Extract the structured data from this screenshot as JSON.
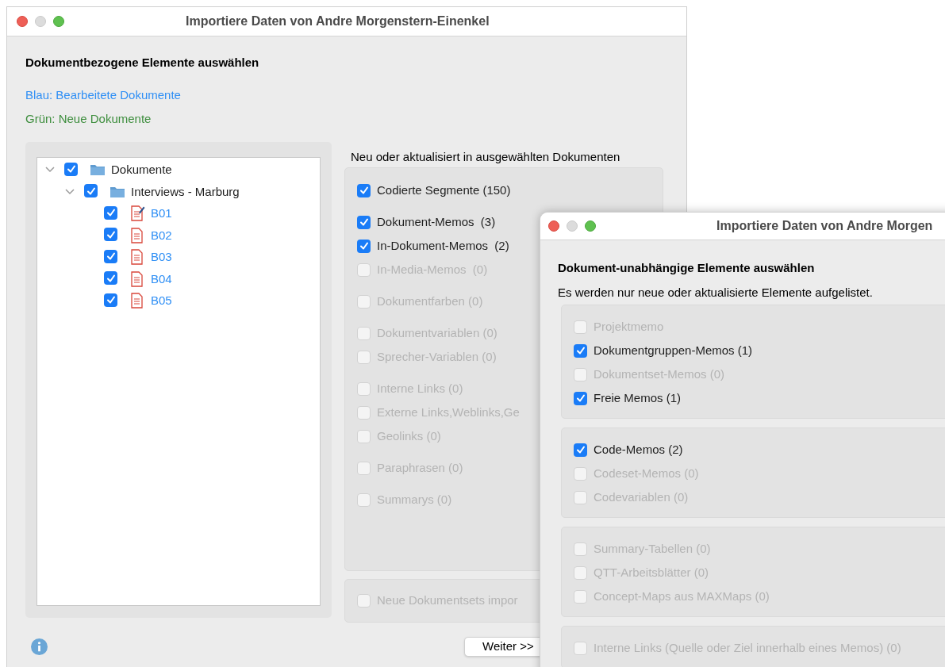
{
  "main_window": {
    "title": "Importiere Daten von Andre Morgenstern-Einenkel",
    "heading": "Dokumentbezogene Elemente auswählen",
    "legend": [
      {
        "kind": "edited",
        "label": "Blau: Bearbeitete Dokumente"
      },
      {
        "kind": "new",
        "label": "Grün: Neue Dokumente"
      }
    ],
    "tree": [
      {
        "label": "Dokumente",
        "kind": "folder",
        "checked": true,
        "expanded": true,
        "children": [
          {
            "label": "Interviews - Marburg",
            "kind": "folder",
            "checked": true,
            "expanded": true,
            "children": [
              {
                "label": "B01",
                "kind": "edited-document",
                "checked": true,
                "color": "#2f8ff5"
              },
              {
                "label": "B02",
                "kind": "document",
                "checked": true,
                "color": "#2f8ff5"
              },
              {
                "label": "B03",
                "kind": "document",
                "checked": true,
                "color": "#2f8ff5"
              },
              {
                "label": "B04",
                "kind": "document",
                "checked": true,
                "color": "#2f8ff5"
              },
              {
                "label": "B05",
                "kind": "document",
                "checked": true,
                "color": "#2f8ff5"
              }
            ]
          }
        ]
      }
    ],
    "options_label": "Neu oder aktualisiert in ausgewählten Dokumenten",
    "option_groups": [
      [
        {
          "label": "Codierte Segmente (150)",
          "checked": true,
          "disabled": false
        }
      ],
      [
        {
          "label": "Dokument-Memos  (3)",
          "checked": true,
          "disabled": false
        },
        {
          "label": "In-Dokument-Memos  (2)",
          "checked": true,
          "disabled": false
        },
        {
          "label": "In-Media-Memos  (0)",
          "checked": false,
          "disabled": true
        }
      ],
      [
        {
          "label": "Dokumentfarben (0)",
          "checked": false,
          "disabled": true
        }
      ],
      [
        {
          "label": "Dokumentvariablen (0)",
          "checked": false,
          "disabled": true
        },
        {
          "label": "Sprecher-Variablen (0)",
          "checked": false,
          "disabled": true
        }
      ],
      [
        {
          "label": "Interne Links (0)",
          "checked": false,
          "disabled": true
        },
        {
          "label": "Externe Links,Weblinks,Ge",
          "checked": false,
          "disabled": true
        },
        {
          "label": "Geolinks (0)",
          "checked": false,
          "disabled": true
        }
      ],
      [
        {
          "label": "Paraphrasen (0)",
          "checked": false,
          "disabled": true
        }
      ],
      [
        {
          "label": "Summarys (0)",
          "checked": false,
          "disabled": true
        }
      ]
    ],
    "extra_option": {
      "label": "Neue Dokumentsets impor",
      "checked": false,
      "disabled": true
    },
    "buttons": [
      "Weiter >>"
    ]
  },
  "second_window": {
    "title": "Importiere Daten von Andre Morgen",
    "heading": "Dokument-unabhängige Elemente auswählen",
    "subtitle": "Es werden nur neue oder aktualisierte Elemente aufgelistet.",
    "option_groups": [
      [
        {
          "label": "Projektmemo",
          "checked": false,
          "disabled": true
        },
        {
          "label": "Dokumentgruppen-Memos (1)",
          "checked": true,
          "disabled": false
        },
        {
          "label": "Dokumentset-Memos (0)",
          "checked": false,
          "disabled": true
        },
        {
          "label": "Freie Memos (1)",
          "checked": true,
          "disabled": false
        }
      ],
      [
        {
          "label": "Code-Memos (2)",
          "checked": true,
          "disabled": false
        },
        {
          "label": "Codeset-Memos (0)",
          "checked": false,
          "disabled": true
        },
        {
          "label": "Codevariablen (0)",
          "checked": false,
          "disabled": true
        }
      ],
      [
        {
          "label": "Summary-Tabellen (0)",
          "checked": false,
          "disabled": true
        },
        {
          "label": "QTT-Arbeitsblätter (0)",
          "checked": false,
          "disabled": true
        },
        {
          "label": "Concept-Maps aus MAXMaps (0)",
          "checked": false,
          "disabled": true
        }
      ],
      [
        {
          "label": "Interne Links (Quelle oder Ziel innerhalb eines Memos) (0)",
          "checked": false,
          "disabled": true
        }
      ]
    ]
  }
}
